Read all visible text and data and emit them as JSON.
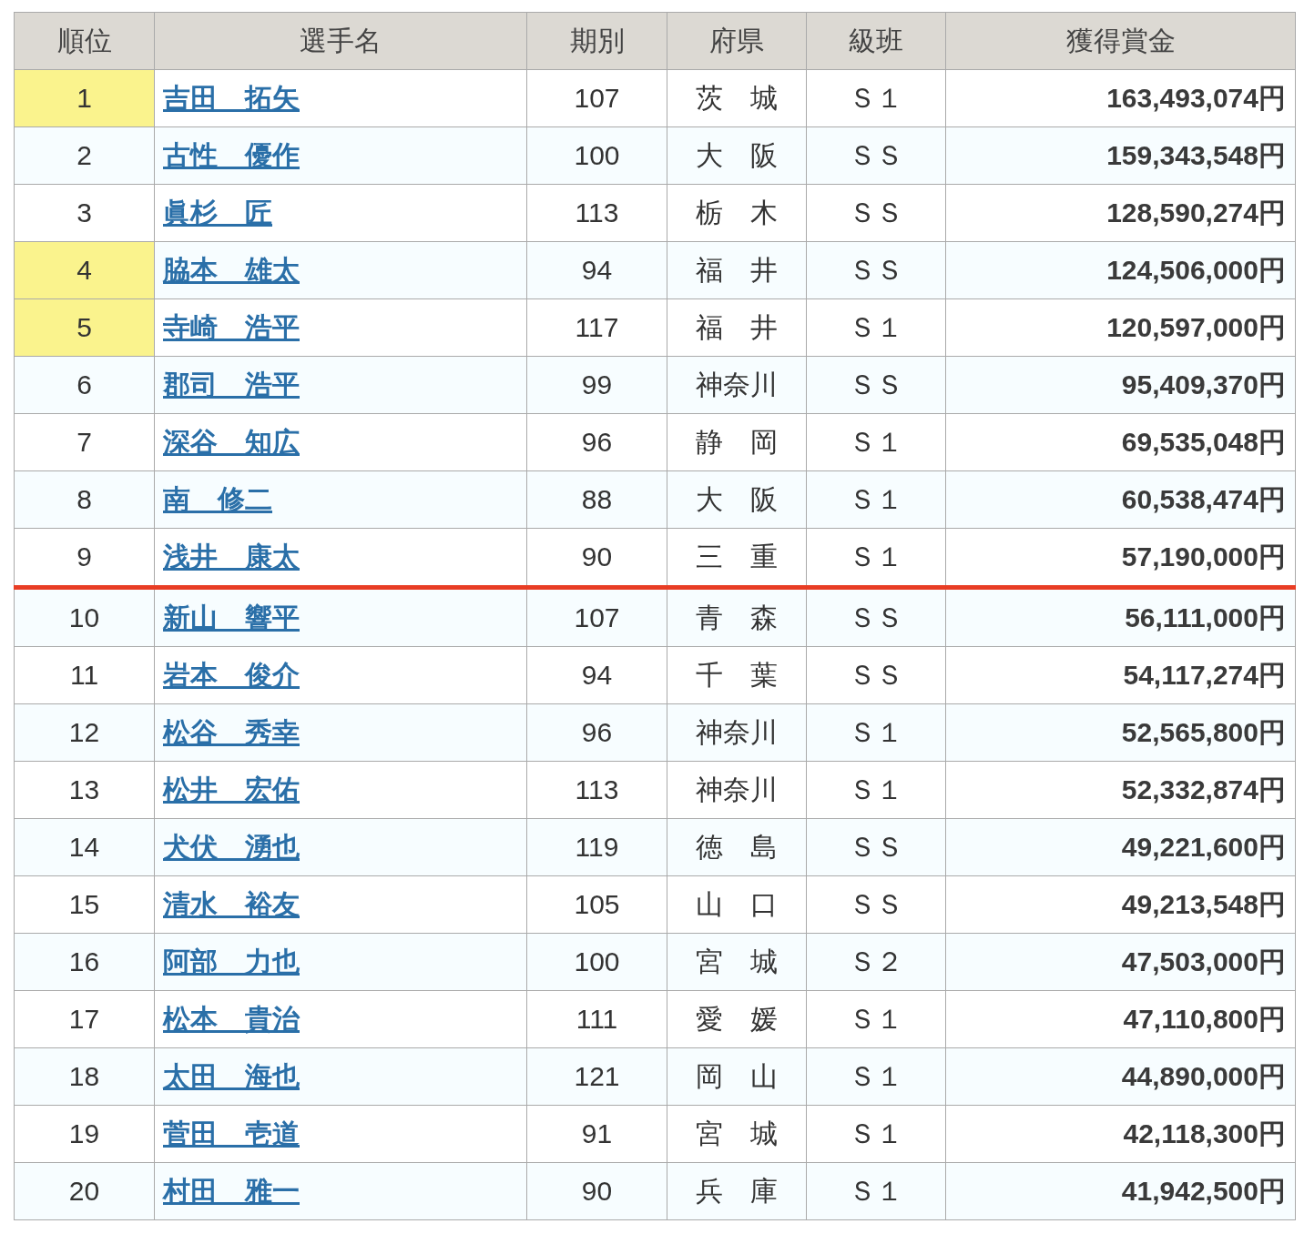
{
  "table": {
    "columns": [
      "順位",
      "選手名",
      "期別",
      "府県",
      "級班",
      "獲得賞金"
    ],
    "rows": [
      {
        "rank": "1",
        "name": "吉田　拓矢",
        "term": "107",
        "prefecture": "茨　城",
        "class": "Ｓ１",
        "prize": "163,493,074円",
        "highlighted": true,
        "cutoff": false
      },
      {
        "rank": "2",
        "name": "古性　優作",
        "term": "100",
        "prefecture": "大　阪",
        "class": "ＳＳ",
        "prize": "159,343,548円",
        "highlighted": false,
        "cutoff": false
      },
      {
        "rank": "3",
        "name": "眞杉　匠",
        "term": "113",
        "prefecture": "栃　木",
        "class": "ＳＳ",
        "prize": "128,590,274円",
        "highlighted": false,
        "cutoff": false
      },
      {
        "rank": "4",
        "name": "脇本　雄太",
        "term": "94",
        "prefecture": "福　井",
        "class": "ＳＳ",
        "prize": "124,506,000円",
        "highlighted": true,
        "cutoff": false
      },
      {
        "rank": "5",
        "name": "寺崎　浩平",
        "term": "117",
        "prefecture": "福　井",
        "class": "Ｓ１",
        "prize": "120,597,000円",
        "highlighted": true,
        "cutoff": false
      },
      {
        "rank": "6",
        "name": "郡司　浩平",
        "term": "99",
        "prefecture": "神奈川",
        "class": "ＳＳ",
        "prize": "95,409,370円",
        "highlighted": false,
        "cutoff": false
      },
      {
        "rank": "7",
        "name": "深谷　知広",
        "term": "96",
        "prefecture": "静　岡",
        "class": "Ｓ１",
        "prize": "69,535,048円",
        "highlighted": false,
        "cutoff": false
      },
      {
        "rank": "8",
        "name": "南　修二",
        "term": "88",
        "prefecture": "大　阪",
        "class": "Ｓ１",
        "prize": "60,538,474円",
        "highlighted": false,
        "cutoff": false
      },
      {
        "rank": "9",
        "name": "浅井　康太",
        "term": "90",
        "prefecture": "三　重",
        "class": "Ｓ１",
        "prize": "57,190,000円",
        "highlighted": false,
        "cutoff": true
      },
      {
        "rank": "10",
        "name": "新山　響平",
        "term": "107",
        "prefecture": "青　森",
        "class": "ＳＳ",
        "prize": "56,111,000円",
        "highlighted": false,
        "cutoff": false
      },
      {
        "rank": "11",
        "name": "岩本　俊介",
        "term": "94",
        "prefecture": "千　葉",
        "class": "ＳＳ",
        "prize": "54,117,274円",
        "highlighted": false,
        "cutoff": false
      },
      {
        "rank": "12",
        "name": "松谷　秀幸",
        "term": "96",
        "prefecture": "神奈川",
        "class": "Ｓ１",
        "prize": "52,565,800円",
        "highlighted": false,
        "cutoff": false
      },
      {
        "rank": "13",
        "name": "松井　宏佑",
        "term": "113",
        "prefecture": "神奈川",
        "class": "Ｓ１",
        "prize": "52,332,874円",
        "highlighted": false,
        "cutoff": false
      },
      {
        "rank": "14",
        "name": "犬伏　湧也",
        "term": "119",
        "prefecture": "徳　島",
        "class": "ＳＳ",
        "prize": "49,221,600円",
        "highlighted": false,
        "cutoff": false
      },
      {
        "rank": "15",
        "name": "清水　裕友",
        "term": "105",
        "prefecture": "山　口",
        "class": "ＳＳ",
        "prize": "49,213,548円",
        "highlighted": false,
        "cutoff": false
      },
      {
        "rank": "16",
        "name": "阿部　力也",
        "term": "100",
        "prefecture": "宮　城",
        "class": "Ｓ２",
        "prize": "47,503,000円",
        "highlighted": false,
        "cutoff": false
      },
      {
        "rank": "17",
        "name": "松本　貴治",
        "term": "111",
        "prefecture": "愛　媛",
        "class": "Ｓ１",
        "prize": "47,110,800円",
        "highlighted": false,
        "cutoff": false
      },
      {
        "rank": "18",
        "name": "太田　海也",
        "term": "121",
        "prefecture": "岡　山",
        "class": "Ｓ１",
        "prize": "44,890,000円",
        "highlighted": false,
        "cutoff": false
      },
      {
        "rank": "19",
        "name": "菅田　壱道",
        "term": "91",
        "prefecture": "宮　城",
        "class": "Ｓ１",
        "prize": "42,118,300円",
        "highlighted": false,
        "cutoff": false
      },
      {
        "rank": "20",
        "name": "村田　雅一",
        "term": "90",
        "prefecture": "兵　庫",
        "class": "Ｓ１",
        "prize": "41,942,500円",
        "highlighted": false,
        "cutoff": false
      }
    ]
  }
}
